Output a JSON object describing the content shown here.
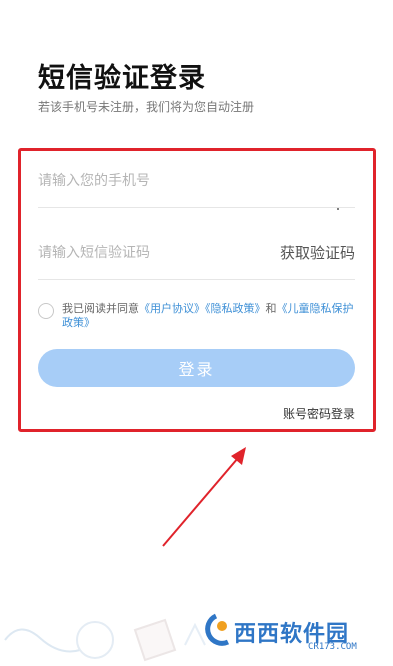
{
  "header": {
    "title": "短信验证登录",
    "subtitle": "若该手机号未注册，我们将为您自动注册"
  },
  "form": {
    "phone_placeholder": "请输入您的手机号",
    "code_placeholder": "请输入短信验证码",
    "get_code_label": "获取验证码",
    "agreement_prefix": "我已阅读并同意",
    "user_agreement": "《用户协议》",
    "privacy_policy": "《隐私政策》",
    "and": "和",
    "child_privacy": "《儿童隐私保护政策》",
    "login_label": "登录",
    "password_login_label": "账号密码登录"
  },
  "watermark": {
    "main": "西西软件园",
    "sub": "CR173.COM"
  },
  "colors": {
    "highlight": "#e0232b",
    "login_button": "#a7cdf7",
    "link": "#3d8fd6"
  }
}
